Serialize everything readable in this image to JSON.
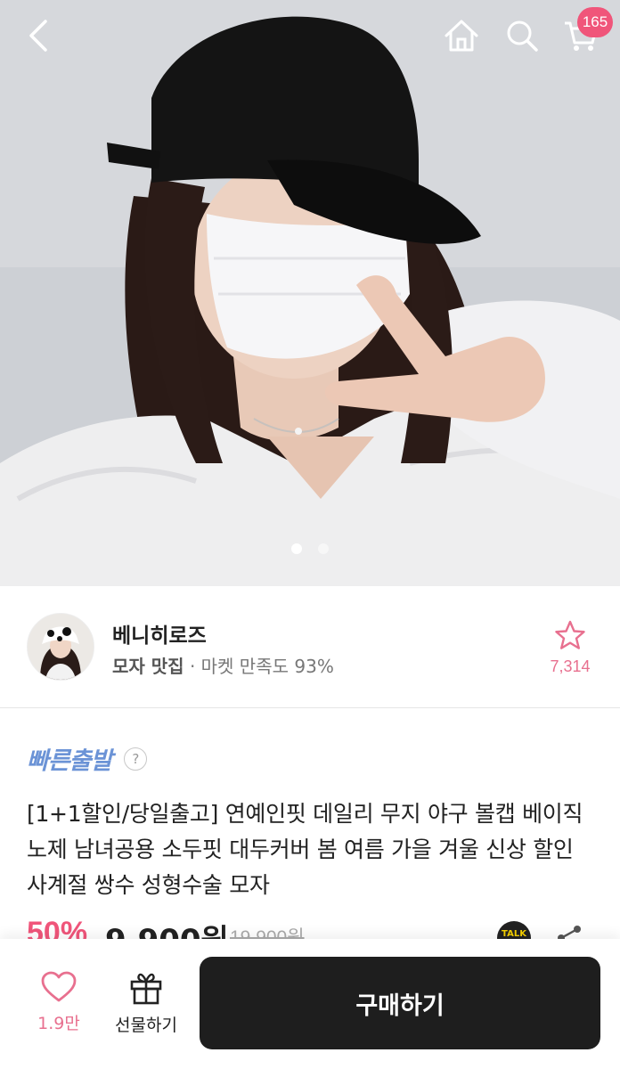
{
  "header": {
    "cart_badge": "165",
    "icons": [
      "back-icon",
      "home-icon",
      "search-icon",
      "cart-icon"
    ]
  },
  "gallery": {
    "current_page": 1,
    "total_pages": 2
  },
  "seller": {
    "name": "베니히로즈",
    "category": "모자 맛집",
    "satisfaction": "· 마켓 만족도 93%",
    "favorites": "7,314"
  },
  "product": {
    "badge": "빠른출발",
    "help": "?",
    "title": "[1+1할인/당일출고] 연예인핏 데일리 무지 야구 볼캡 베이직 노제 남녀공용 소두핏 대두커버 봄 여름 가을 겨울 신상 할인 사계절 쌍수 성형수술 모자",
    "discount": "50%",
    "price": "9,900원",
    "original_price": "19,900원",
    "talk_label": "TALK"
  },
  "bottom_bar": {
    "like_count": "1.9만",
    "gift_label": "선물하기",
    "buy_label": "구매하기"
  },
  "colors": {
    "accent_pink": "#f0557a",
    "fast_blue": "#6b93d6",
    "buy_button": "#1e1e1e"
  }
}
